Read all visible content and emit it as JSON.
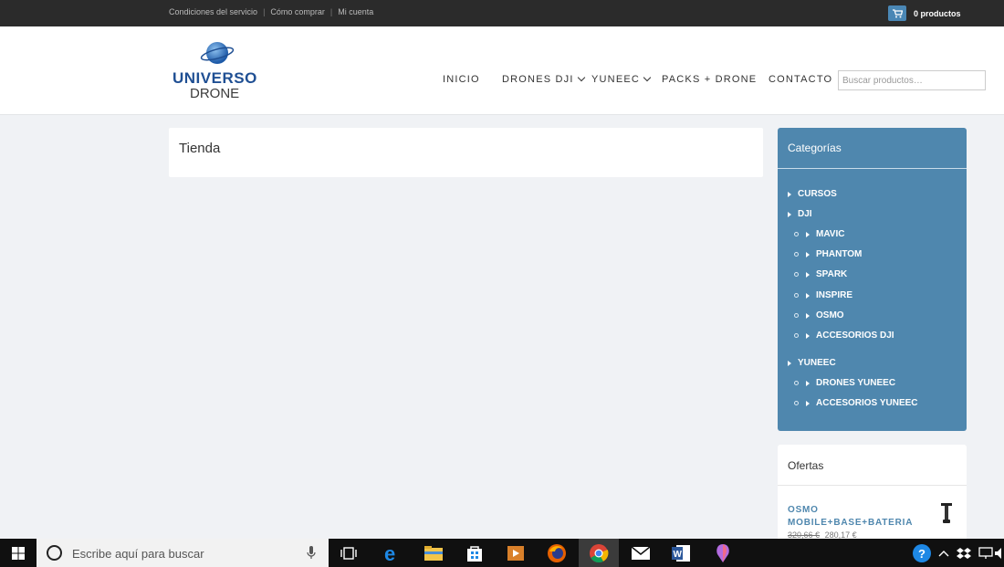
{
  "topbar": {
    "links": [
      "Condiciones del servicio",
      "Cómo comprar",
      "Mi cuenta"
    ],
    "cart_label": "0 productos"
  },
  "header": {
    "logo": {
      "word1": "UNIVERSO",
      "word2": "DRONE"
    },
    "nav": [
      {
        "label": "INICIO",
        "dropdown": false
      },
      {
        "label": "DRONES DJI",
        "dropdown": true
      },
      {
        "label": "YUNEEC",
        "dropdown": true
      },
      {
        "label": "PACKS + DRONE",
        "dropdown": false
      },
      {
        "label": "CONTACTO",
        "dropdown": false
      }
    ],
    "search_placeholder": "Buscar productos…"
  },
  "main": {
    "title": "Tienda"
  },
  "categories": {
    "title": "Categorías",
    "items": [
      {
        "label": "CURSOS",
        "level": 0
      },
      {
        "label": "DJI",
        "level": 0
      },
      {
        "label": "MAVIC",
        "level": 1
      },
      {
        "label": "PHANTOM",
        "level": 1
      },
      {
        "label": "SPARK",
        "level": 1
      },
      {
        "label": "INSPIRE",
        "level": 1
      },
      {
        "label": "OSMO",
        "level": 1
      },
      {
        "label": "ACCESORIOS DJI",
        "level": 1
      },
      {
        "label": "YUNEEC",
        "level": 0
      },
      {
        "label": "DRONES YUNEEC",
        "level": 1
      },
      {
        "label": "ACCESORIOS YUNEEC",
        "level": 1
      }
    ]
  },
  "offers": {
    "title": "Ofertas",
    "product": {
      "name": "OSMO MOBILE+BASE+BATERIA",
      "old_price": "320,66 €",
      "price": "280,17 €"
    }
  },
  "taskbar": {
    "search_text": "Escribe aquí para buscar",
    "apps": [
      "task-view-icon",
      "edge-icon",
      "file-explorer-icon",
      "store-icon",
      "media-player-icon",
      "firefox-icon",
      "chrome-icon",
      "mail-icon",
      "word-icon",
      "paint3d-icon"
    ]
  },
  "colors": {
    "accent": "#4f87ae",
    "topbar": "#2b2b2b",
    "taskbar": "#101010"
  }
}
